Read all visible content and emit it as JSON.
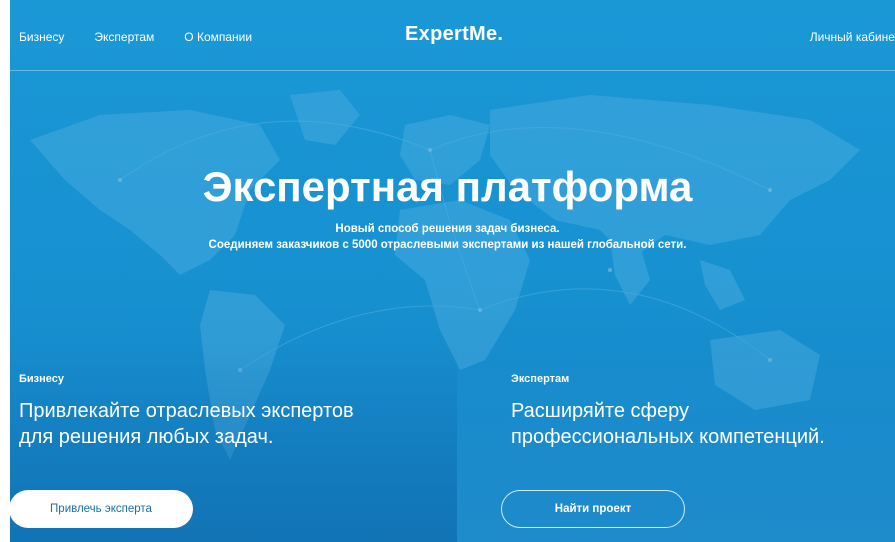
{
  "header": {
    "nav": [
      "Бизнесу",
      "Экспертам",
      "О Компании"
    ],
    "logo": "ExpertMe.",
    "cabinet": "Личный кабинет"
  },
  "hero": {
    "title": "Экспертная платформа",
    "subtitle_line1": "Новый способ решения задач бизнеса.",
    "subtitle_line2": "Соединяем заказчиков с 5000 отраслевыми экспертами из нашей глобальной сети."
  },
  "business": {
    "tag": "Бизнесу",
    "headline_line1": "Привлекайте отраслевых экспертов",
    "headline_line2": "для решения любых задач.",
    "button": "Привлечь эксперта"
  },
  "experts": {
    "tag": "Экспертам",
    "headline_line1": "Расширяйте сферу",
    "headline_line2": "профессиональных компетенций.",
    "button": "Найти проект"
  },
  "colors": {
    "hero_bg": "#1a98d6",
    "button_text": "#1a6fae",
    "text": "#ffffff"
  }
}
